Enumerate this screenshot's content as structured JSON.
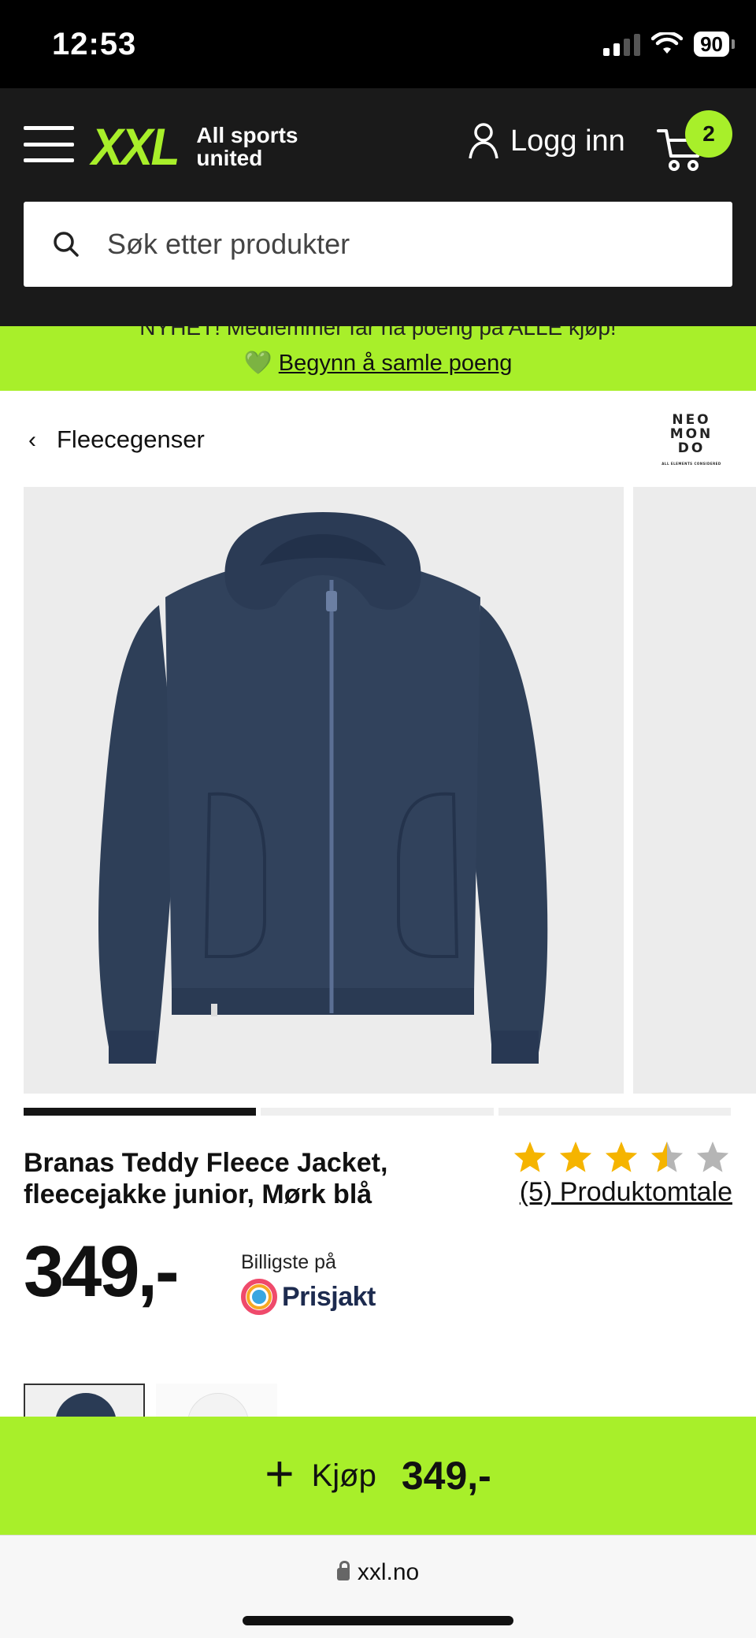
{
  "status_bar": {
    "time": "12:53",
    "battery": "90"
  },
  "header": {
    "logo": "XXL",
    "tagline": "All sports united",
    "login_label": "Logg inn",
    "cart_count": "2",
    "search_placeholder": "Søk etter produkter"
  },
  "promo": {
    "line1": "NYHET! Medlemmer får nå poeng på ALLE kjøp!",
    "emoji": "💚",
    "link": "Begynn å samle poeng"
  },
  "breadcrumb": {
    "label": "Fleecegenser"
  },
  "brand": {
    "name_lines": [
      "NEO",
      "MON",
      "DO"
    ],
    "subline": "ALL ELEMENTS CONSIDERED"
  },
  "gallery": {
    "slide_count": 3,
    "active_index": 0
  },
  "product": {
    "title": "Branas Teddy Fleece Jacket, fleecejakke junior, Mørk blå",
    "rating": 3.5,
    "rating_max": 5,
    "reviews_label": "(5) Produktomtale",
    "price": "349,-",
    "cheapest_label": "Billigste på",
    "cheapest_source": "Prisjakt"
  },
  "buy_bar": {
    "label": "Kjøp",
    "price": "349,-"
  },
  "browser": {
    "url": "xxl.no"
  },
  "colors": {
    "brand_green": "#a8ef2a",
    "header_bg": "#1a1a1a",
    "star_filled": "#f5b400",
    "star_empty": "#b5b5b5",
    "jacket": "#2e3f58"
  }
}
